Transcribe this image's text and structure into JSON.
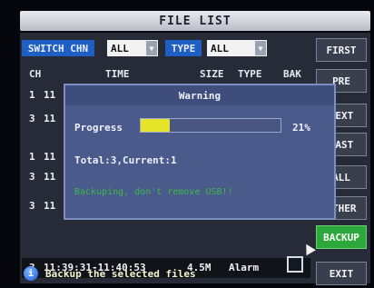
{
  "window": {
    "title": "FILE LIST"
  },
  "filters": {
    "switch_label": "SWITCH CHN",
    "channel_value": "ALL",
    "type_label": "TYPE",
    "type_value": "ALL"
  },
  "list": {
    "headers": {
      "ch": "CH",
      "time": "TIME",
      "size": "SIZE",
      "type": "TYPE",
      "bak": "BAK"
    },
    "rows": [
      {
        "ch": "1",
        "time": "11"
      },
      {
        "ch": "3",
        "time": "11"
      },
      {
        "ch": "1",
        "time": "11"
      },
      {
        "ch": "3",
        "time": "11"
      },
      {
        "ch": "3",
        "time": "11"
      },
      {
        "ch": "3",
        "time": "11:39:31-11:40:53",
        "size": "4.5M",
        "type": "Alarm"
      }
    ]
  },
  "sidebar": {
    "buttons": [
      "FIRST",
      "PRE",
      "NEXT",
      "LAST",
      "ALL",
      "OTHER",
      "BACKUP",
      "EXIT"
    ]
  },
  "dialog": {
    "title": "Warning",
    "progress_label": "Progress",
    "progress_percent_text": "21%",
    "progress_value": 0.21,
    "total_text": "Total:3,Current:1",
    "status_text": "Backuping, don't remove USB!!"
  },
  "tip": {
    "text": "Backup the selected files"
  },
  "colors": {
    "accent_blue": "#1f5fc4",
    "progress_yellow": "#e6e42a",
    "backup_green": "#2da83a",
    "status_green": "#38b94a"
  }
}
